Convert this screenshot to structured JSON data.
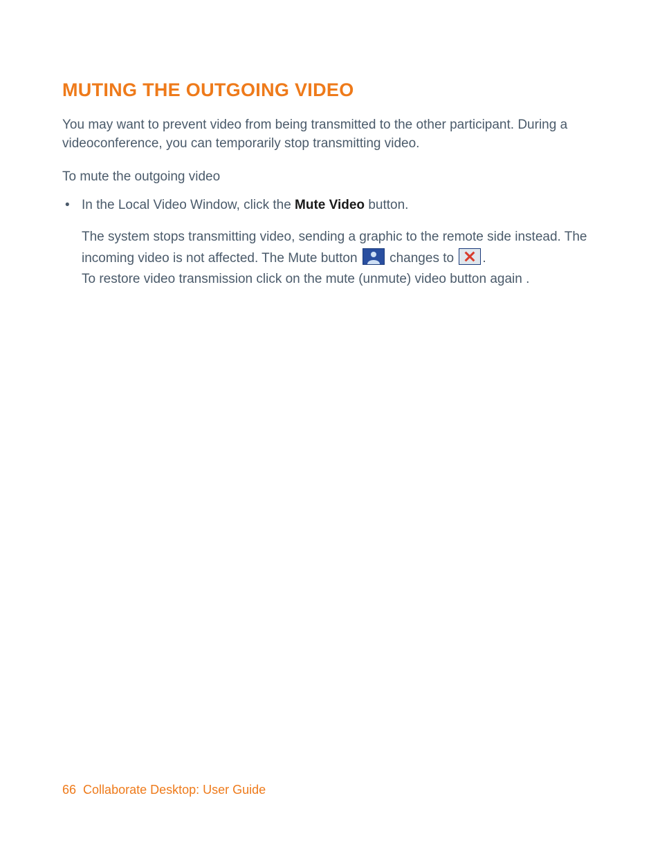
{
  "heading": "MUTING THE OUTGOING VIDEO",
  "intro": "You may want to prevent video from being transmitted to the other participant. During a videoconference, you can temporarily stop transmitting video.",
  "lead": "To mute the outgoing video",
  "bullet": {
    "prefix": "In the Local Video Window, click the ",
    "bold": "Mute Video",
    "suffix": " button."
  },
  "detail": {
    "part1": "The system stops transmitting video, sending a graphic to the remote side instead. The incoming video is not affected. The Mute button ",
    "part2": " changes to ",
    "part3": ".",
    "restore": "To restore video transmission click on the mute (unmute) video button again ."
  },
  "footer": {
    "page": "66",
    "title": "Collaborate Desktop: User Guide"
  },
  "icons": {
    "mute": "mute-video-icon",
    "muted": "muted-video-icon"
  }
}
